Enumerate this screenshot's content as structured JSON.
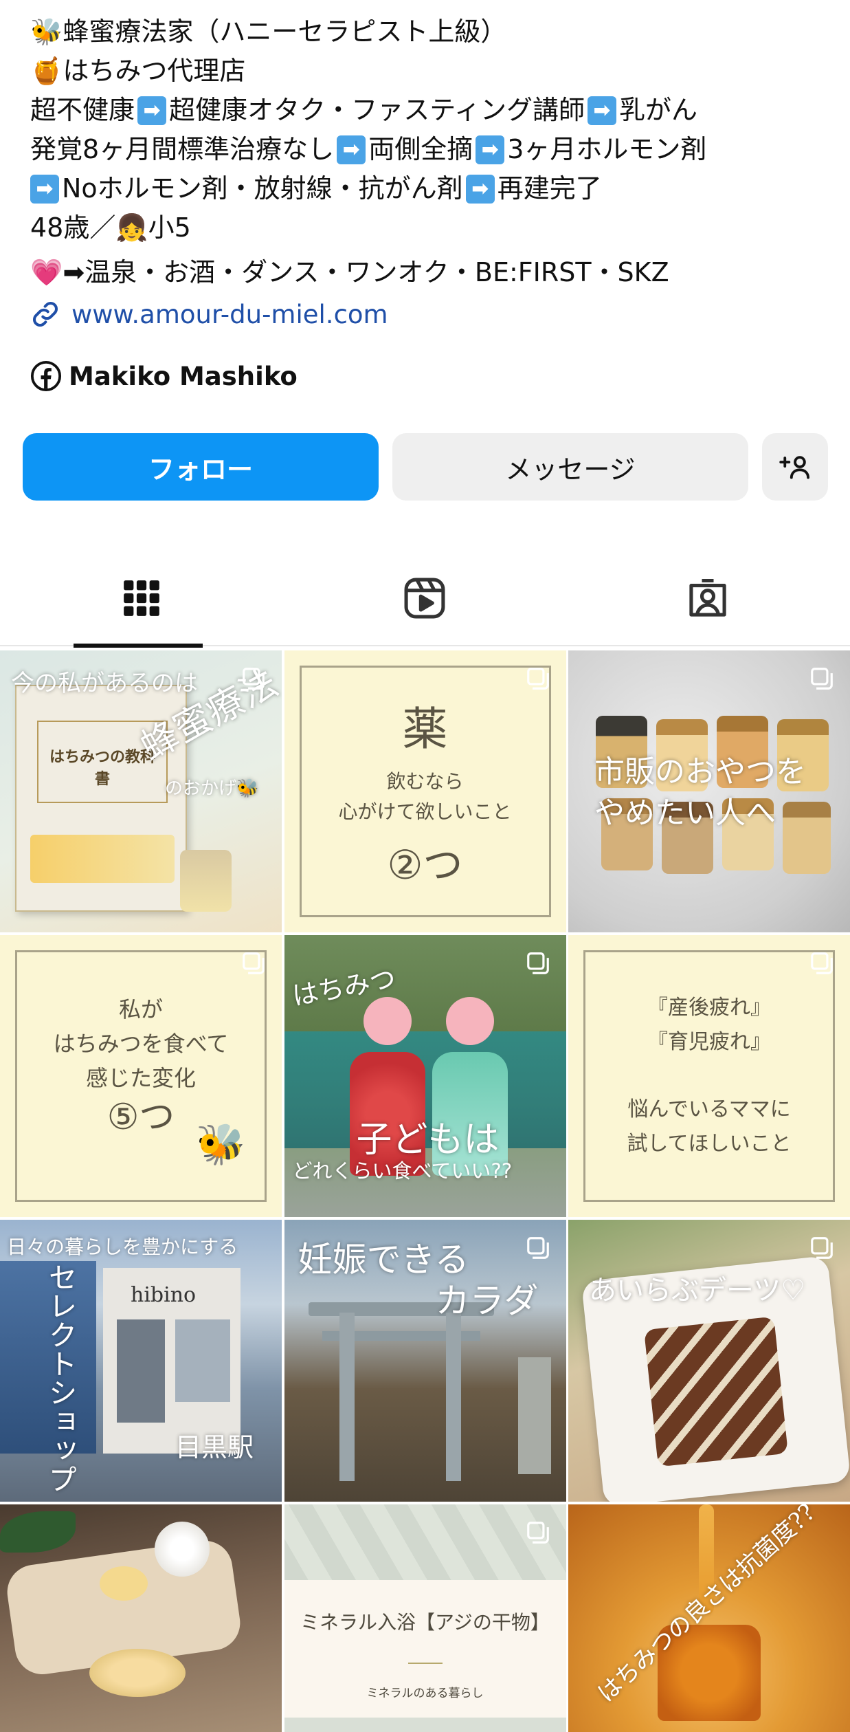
{
  "bio": {
    "line1": "🐝蜂蜜療法家（ハニーセラピスト上級）",
    "line2": "🍯はちみつ代理店",
    "line3_a": "超不健康",
    "line3_b": "超健康オタク・ファスティング講師",
    "line3_c": "乳がん",
    "line4_a": "発覚8ヶ月間標準治療なし",
    "line4_b": "両側全摘",
    "line4_c": "3ヶ月ホルモン剤",
    "line5_a": "Noホルモン剤・放射線・抗がん剤",
    "line5_b": "再建完了",
    "line6": "48歳／👧小5",
    "line7": "💗➡温泉・お酒・ダンス・ワンオク・BE:FIRST・SKZ",
    "arrow": "➡"
  },
  "link": {
    "url": "www.amour-du-miel.com",
    "icon": "link-icon"
  },
  "facebook": {
    "name": "Makiko Mashiko",
    "icon": "facebook-icon"
  },
  "buttons": {
    "follow": "フォロー",
    "message": "メッセージ",
    "add_person_icon": "add-person-icon"
  },
  "tabs": [
    {
      "name": "posts-grid",
      "icon": "grid-icon",
      "active": true
    },
    {
      "name": "reels",
      "icon": "reels-icon",
      "active": false
    },
    {
      "name": "tagged",
      "icon": "tagged-icon",
      "active": false
    }
  ],
  "posts": {
    "p1": {
      "top": "今の私があるのは",
      "big": "蜂蜜療法",
      "bottom": "のおかげ🐝",
      "book_title": "はちみつの教科書"
    },
    "p2": {
      "big": "薬",
      "line1": "飲むなら",
      "line2": "心がけて欲しいこと",
      "count": "②つ"
    },
    "p3": {
      "line1": "市販のおやつを",
      "line2": "やめたい人へ"
    },
    "p4": {
      "line1": "私が",
      "line2": "はちみつを食べて",
      "line3": "感じた変化",
      "count": "⑤つ"
    },
    "p5": {
      "top": "はちみつ",
      "big": "子どもは",
      "bottom": "どれくらい食べていい??"
    },
    "p6": {
      "line1": "『産後疲れ』",
      "line2": "『育児疲れ』",
      "line3": "悩んでいるママに",
      "line4": "試してほしいこと"
    },
    "p7": {
      "top": "日々の暮らしを豊かにする",
      "vertical": "セレクトショップ",
      "station": "目黒駅",
      "sign": "hibino"
    },
    "p8": {
      "line1": "妊娠できる",
      "line2": "カラダ"
    },
    "p9": {
      "line1": "あいらぶデーツ♡"
    },
    "p10": {},
    "p11": {
      "title": "ミネラル入浴【アジの干物】",
      "sub": "ミネラルのある暮らし"
    },
    "p12": {
      "text": "はちみつの良さは抗菌度??"
    }
  },
  "colors": {
    "follow": "#0d95f5",
    "link": "#1f4fa8",
    "cream": "#fbf6d4"
  }
}
